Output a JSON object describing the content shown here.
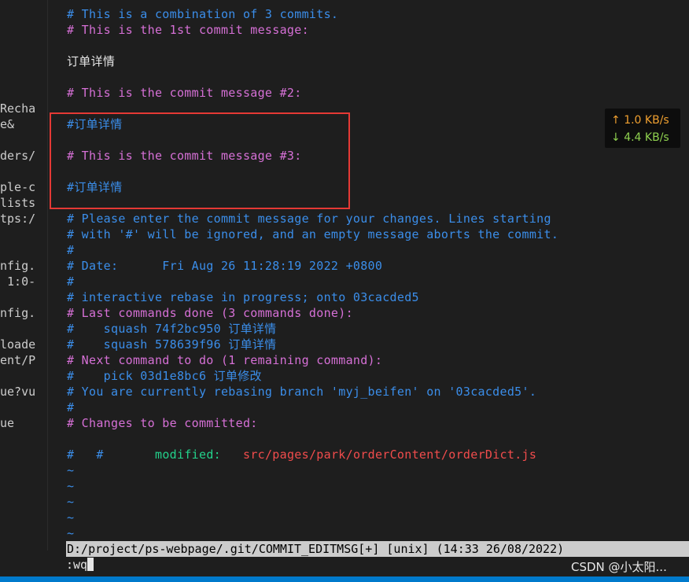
{
  "left_panel": {
    "lines": [
      {
        "text": "Recha",
        "row": 6
      },
      {
        "text": "e&",
        "row": 7
      },
      {
        "text": "ders/",
        "row": 9
      },
      {
        "text": "ple-c",
        "row": 11
      },
      {
        "text": "lists",
        "row": 12
      },
      {
        "text": "tps:/",
        "row": 13
      },
      {
        "text": "nfig.",
        "row": 16
      },
      {
        "text": " 1:0-",
        "row": 17
      },
      {
        "text": "nfig.",
        "row": 19
      },
      {
        "text": "loade",
        "row": 21
      },
      {
        "text": "ent/P",
        "row": 22
      },
      {
        "text": "ue?vu",
        "row": 24
      },
      {
        "text": "ue",
        "row": 26
      }
    ]
  },
  "editor": {
    "lines": [
      {
        "row": 0,
        "color": "blue",
        "text": "# This is a combination of 3 commits."
      },
      {
        "row": 1,
        "color": "mag",
        "text": "# This is the 1st commit message:"
      },
      {
        "row": 3,
        "color": "white",
        "text": "订单详情"
      },
      {
        "row": 5,
        "color": "mag",
        "text": "# This is the commit message #2:"
      },
      {
        "row": 7,
        "color": "blue",
        "text": "#订单详情"
      },
      {
        "row": 9,
        "color": "mag",
        "text": "# This is the commit message #3:"
      },
      {
        "row": 11,
        "color": "blue",
        "text": "#订单详情"
      },
      {
        "row": 13,
        "color": "blue",
        "text": "# Please enter the commit message for your changes. Lines starting"
      },
      {
        "row": 14,
        "color": "blue",
        "text": "# with '#' will be ignored, and an empty message aborts the commit."
      },
      {
        "row": 15,
        "color": "blue",
        "text": "#"
      },
      {
        "row": 16,
        "color": "blue",
        "text": "# Date:      Fri Aug 26 11:28:19 2022 +0800"
      },
      {
        "row": 17,
        "color": "blue",
        "text": "#"
      },
      {
        "row": 18,
        "color": "blue",
        "text": "# interactive rebase in progress; onto 03cacded5"
      },
      {
        "row": 19,
        "color": "mag",
        "text": "# Last commands done (3 commands done):"
      },
      {
        "row": 20,
        "color": "blue",
        "text": "#    squash 74f2bc950 订单详情"
      },
      {
        "row": 21,
        "color": "blue",
        "text": "#    squash 578639f96 订单详情"
      },
      {
        "row": 22,
        "color": "mag",
        "text": "# Next command to do (1 remaining command):"
      },
      {
        "row": 23,
        "color": "blue",
        "text": "#    pick 03d1e8bc6 订单修改"
      },
      {
        "row": 24,
        "color": "blue",
        "text": "# You are currently rebasing branch 'myj_beifen' on '03cacded5'."
      },
      {
        "row": 25,
        "color": "blue",
        "text": "#"
      },
      {
        "row": 26,
        "color": "mag",
        "text": "# Changes to be committed:"
      },
      {
        "row": 28,
        "color": "blue",
        "text": "#"
      },
      {
        "row": 29,
        "color": "tilde",
        "text": "~"
      },
      {
        "row": 30,
        "color": "tilde",
        "text": "~"
      },
      {
        "row": 31,
        "color": "tilde",
        "text": "~"
      },
      {
        "row": 32,
        "color": "tilde",
        "text": "~"
      },
      {
        "row": 33,
        "color": "tilde",
        "text": "~"
      }
    ],
    "modified_line": {
      "row": 27,
      "hash": "#",
      "label": "modified:",
      "path": "src/pages/park/orderContent/orderDict.js"
    }
  },
  "speed": {
    "up_arrow": "↑",
    "up": "1.0 KB/s",
    "down_arrow": "↓",
    "down": "4.4 KB/s"
  },
  "statusline": "D:/project/ps-webpage/.git/COMMIT_EDITMSG[+] [unix] (14:33 26/08/2022)",
  "command": ":wq",
  "watermark": "CSDN @小太阳...",
  "colors": {
    "blue": "#3b8eea",
    "magenta": "#d670d6",
    "green": "#23d18b",
    "red": "#f14c4c",
    "highlight_border": "#e53935"
  }
}
